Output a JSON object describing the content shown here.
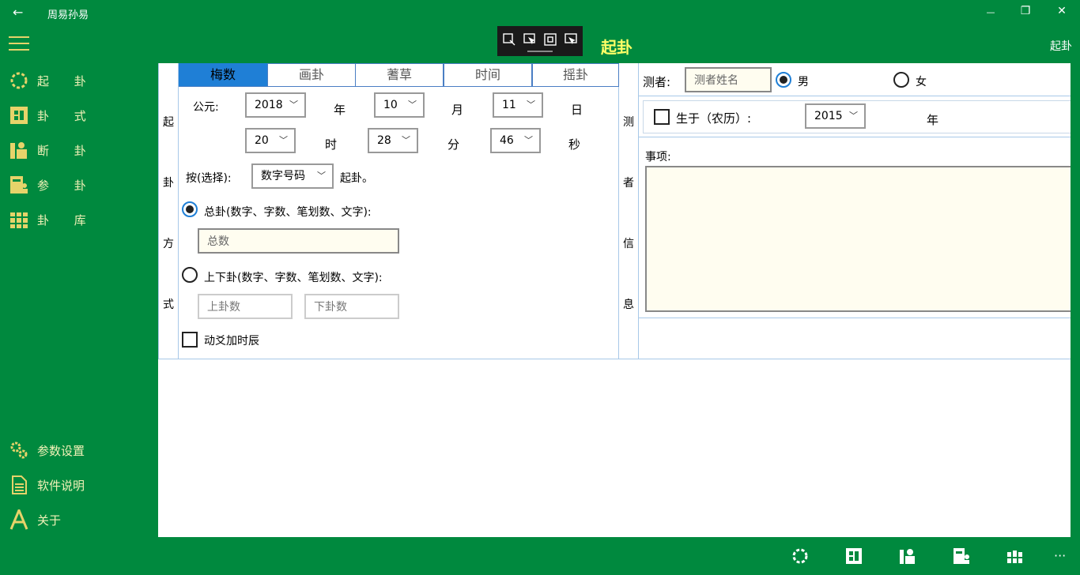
{
  "window": {
    "title": "周易孙易",
    "back_glyph": "←",
    "minimize_glyph": "—",
    "restore_glyph": "❐",
    "close_glyph": "✕"
  },
  "header": {
    "page_title": "起卦",
    "right_label": "起卦",
    "title_color": "#ffff66"
  },
  "sidebar": {
    "hamburger_icon": "hamburger-icon",
    "items": [
      {
        "label": "起 卦",
        "icon": "ring-icon"
      },
      {
        "label": "卦 式",
        "icon": "grid-icon"
      },
      {
        "label": "断 卦",
        "icon": "person-book-icon"
      },
      {
        "label": "参 卦",
        "icon": "people-icon"
      },
      {
        "label": "卦 库",
        "icon": "library-icon"
      }
    ],
    "bottom_items": [
      {
        "label": "参数设置",
        "icon": "gears-icon"
      },
      {
        "label": "软件说明",
        "icon": "document-icon"
      },
      {
        "label": "关于",
        "icon": "letter-a-icon"
      }
    ]
  },
  "method_panel": {
    "vertical_label": [
      "起",
      "卦",
      "方",
      "式"
    ],
    "tabs": [
      {
        "label": "梅数",
        "active": true
      },
      {
        "label": "画卦",
        "active": false
      },
      {
        "label": "蓍草",
        "active": false
      },
      {
        "label": "时间",
        "active": false
      },
      {
        "label": "摇卦",
        "active": false
      }
    ],
    "era_label": "公元:",
    "year": "2018",
    "year_unit": "年",
    "month": "10",
    "month_unit": "月",
    "day": "11",
    "day_unit": "日",
    "hour": "20",
    "hour_unit": "时",
    "minute": "28",
    "minute_unit": "分",
    "second": "46",
    "second_unit": "秒",
    "select_prefix": "按(选择):",
    "select_value": "数字号码",
    "select_suffix": "起卦。",
    "option_total": "总卦(数字、字数、笔划数、文字):",
    "total_placeholder": "总数",
    "option_updown": "上下卦(数字、字数、笔划数、文字):",
    "upper_placeholder": "上卦数",
    "lower_placeholder": "下卦数",
    "checkbox_label": "动爻加时辰"
  },
  "person_panel": {
    "vertical_label": [
      "测",
      "者",
      "信",
      "息"
    ],
    "name_label": "测者:",
    "name_placeholder": "测者姓名",
    "male": "男",
    "female": "女",
    "born_label": "生于（农历）:",
    "born_year": "2015",
    "born_unit": "年",
    "matter_label": "事项:"
  },
  "colors": {
    "app_green": "#00893e",
    "accent_blue": "#1f7fd6",
    "label_yellow": "#f2f2b8"
  }
}
